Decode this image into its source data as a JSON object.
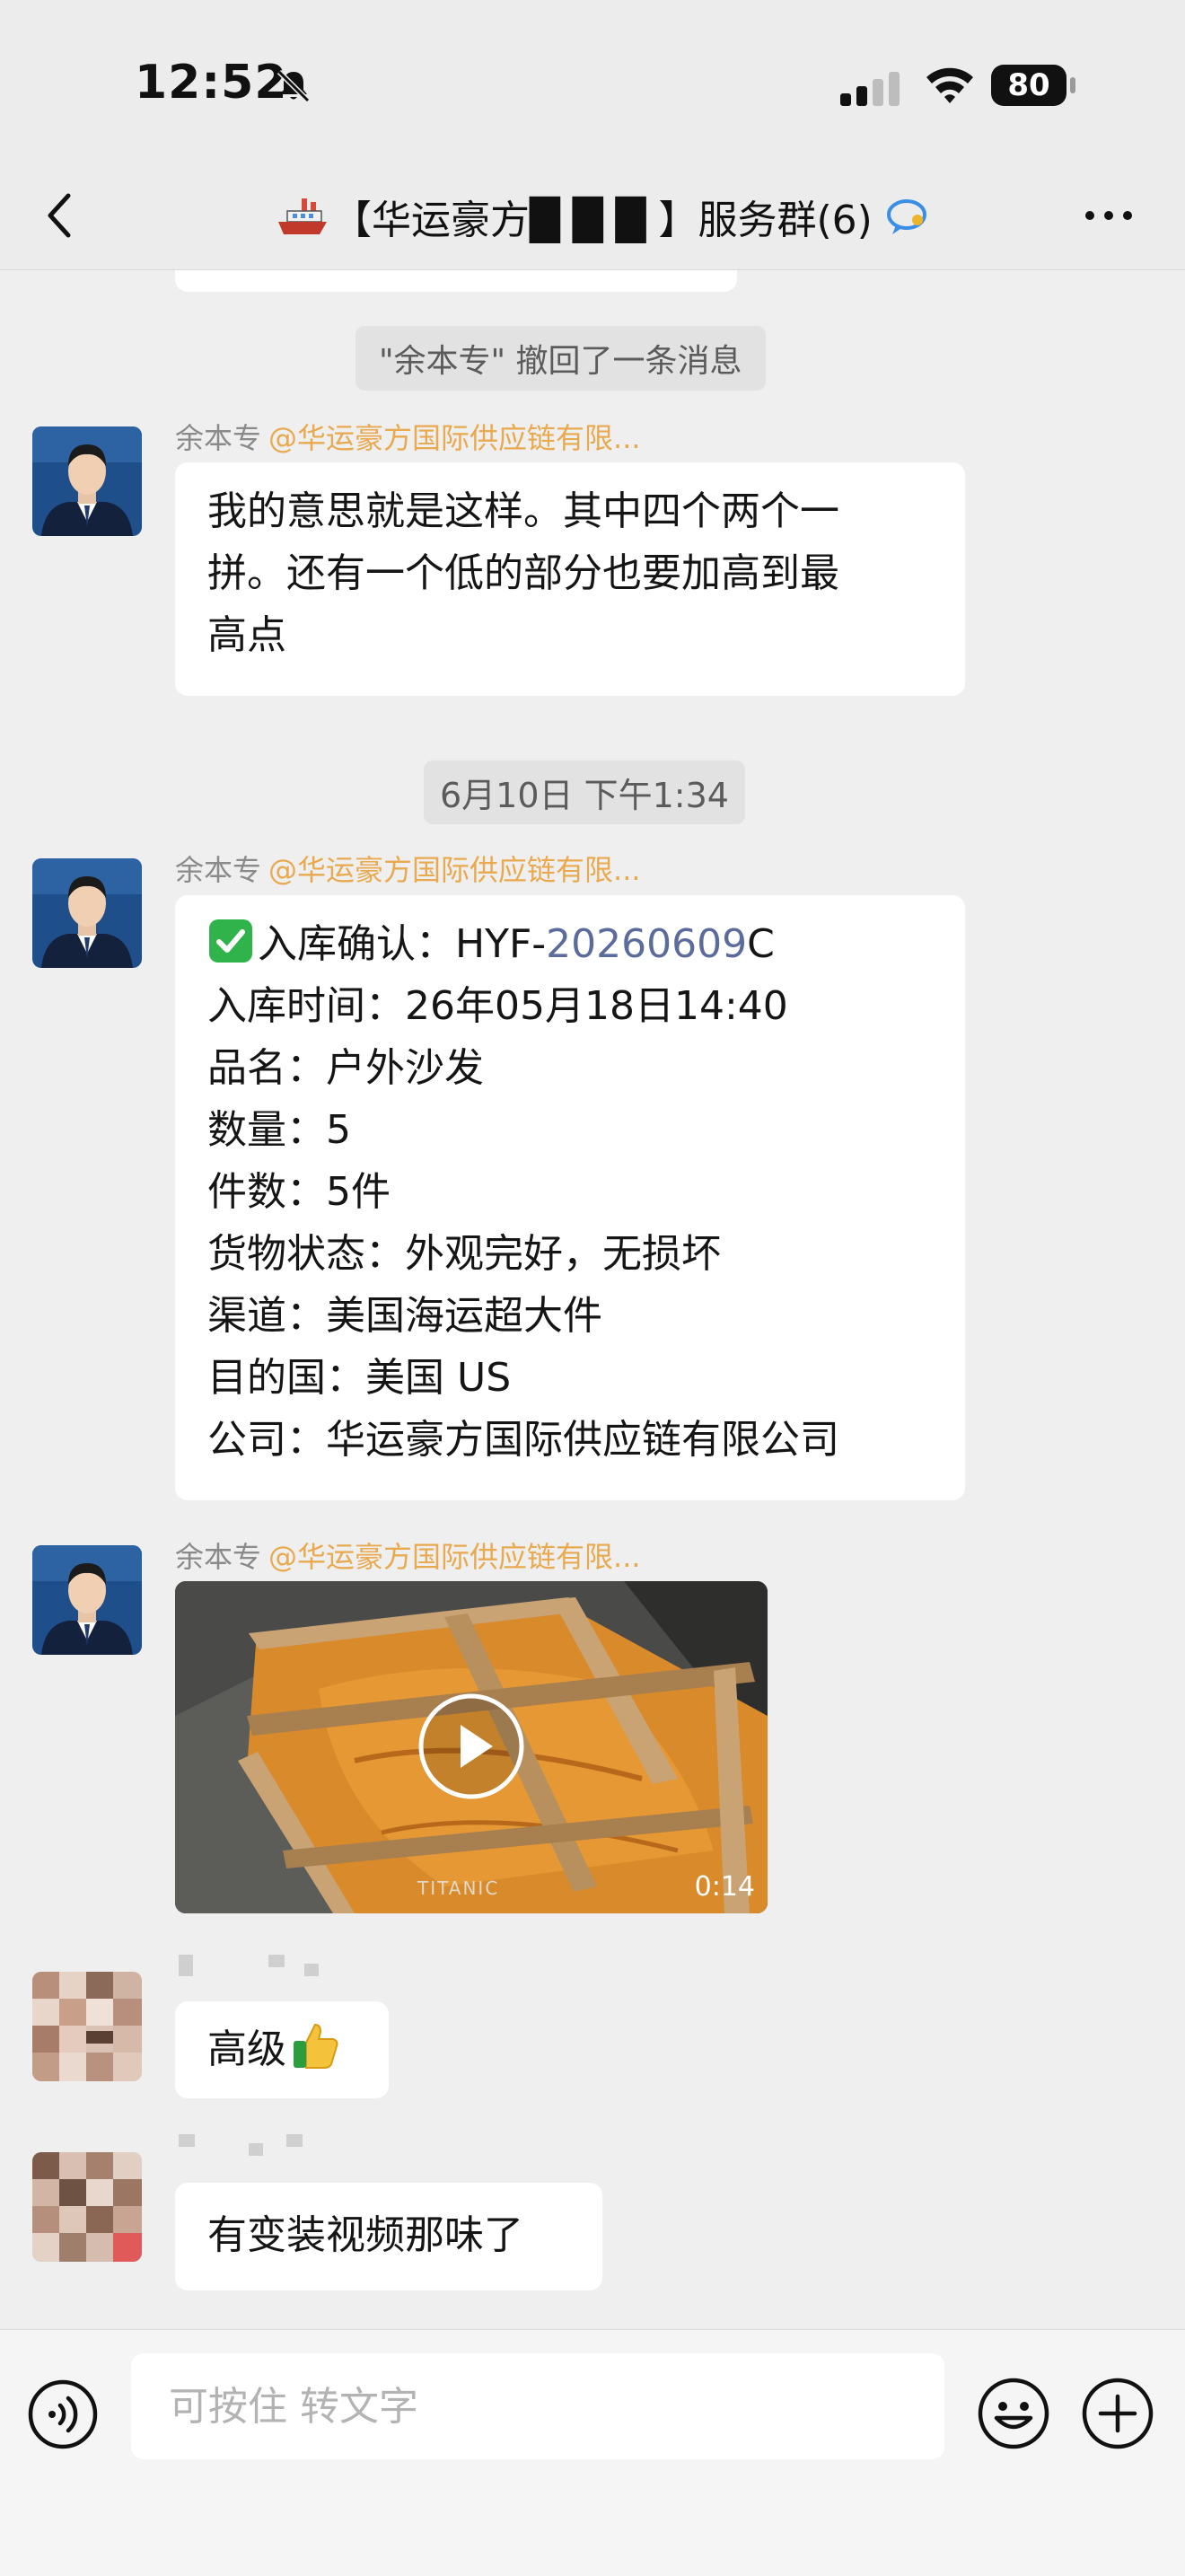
{
  "status_bar": {
    "time": "12:52",
    "battery": "80"
  },
  "nav": {
    "title": "【华运豪方█ █ █ 】服务群(6)"
  },
  "messages": {
    "recall_notice": "\"余本专\" 撤回了一条消息",
    "msg1": {
      "sender": "余本专",
      "tag": "@华运豪方国际供应链有限...",
      "lines": [
        "我的意思就是这样。其中四个两个一",
        "拼。还有一个低的部分也要加高到最",
        "高点"
      ]
    },
    "timestamp": "6月10日 下午1:34",
    "msg2": {
      "sender": "余本专",
      "tag": "@华运豪方国际供应链有限...",
      "line1_prefix": "入库确认：HYF-",
      "line1_num": "20260609",
      "line1_suffix": "C",
      "lines": [
        "入库时间：26年05月18日14:40",
        "品名：户外沙发",
        "数量：5",
        "件数：5件",
        "货物状态：外观完好，无损坏",
        "渠道：美国海运超大件",
        "目的国：美国  US",
        "公司：华运豪方国际供应链有限公司"
      ]
    },
    "msg3": {
      "sender": "余本专",
      "tag": "@华运豪方国际供应链有限...",
      "video_duration": "0:14",
      "video_watermark": "TITANIC"
    },
    "msg4": {
      "text": "高级"
    },
    "msg5": {
      "text": "有变装视频那味了"
    }
  },
  "input": {
    "placeholder": "可按住 转文字"
  },
  "colors": {
    "tag": "#e8a94f",
    "link": "#5b6c9c",
    "background": "#efefef"
  },
  "icons": [
    "back-icon",
    "ship-icon",
    "chat-icon",
    "more-icon",
    "bell-off-icon",
    "signal-icon",
    "wifi-icon",
    "check-emoji-icon",
    "thumbs-up-icon",
    "play-icon",
    "voice-icon",
    "emoji-icon",
    "plus-icon"
  ]
}
